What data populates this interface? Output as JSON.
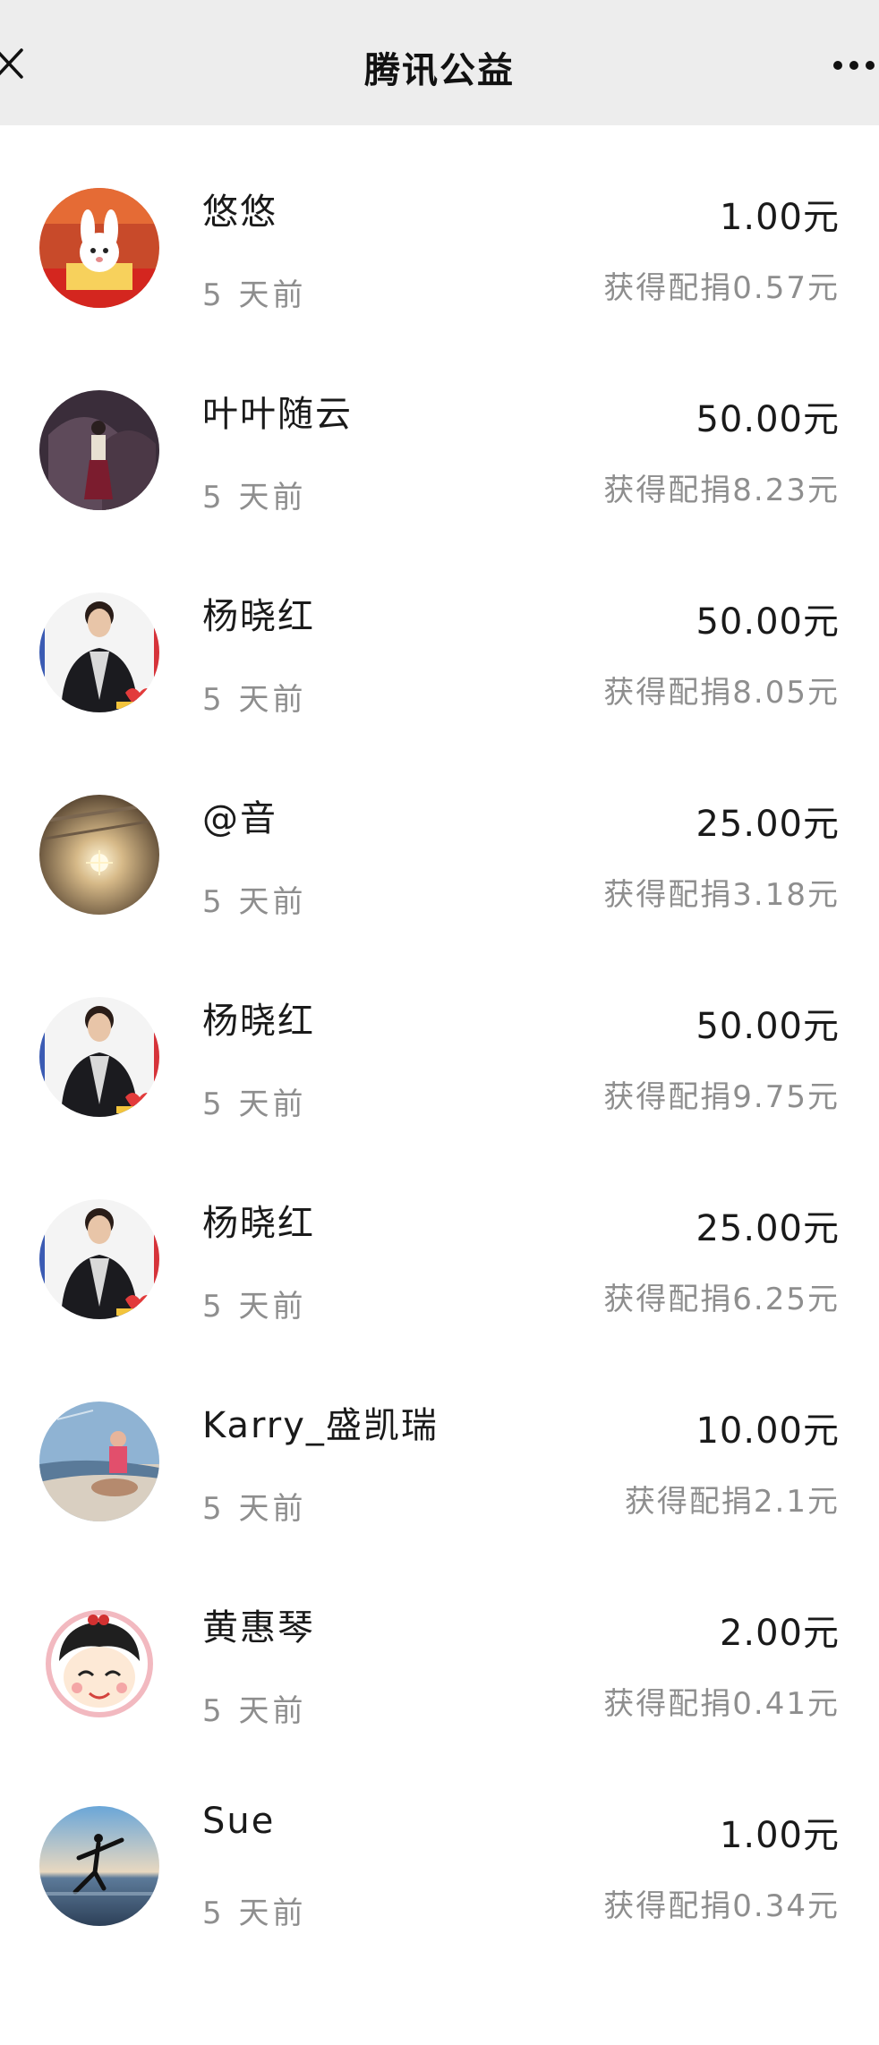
{
  "header": {
    "title": "腾讯公益",
    "close_icon": "close-icon",
    "more_icon": "more-icon"
  },
  "donations": [
    {
      "name": "悠悠",
      "time": "5 天前",
      "amount": "1.00元",
      "match": "获得配捐0.57元",
      "avatar": "rabbit-avatar"
    },
    {
      "name": "叶叶随云",
      "time": "5 天前",
      "amount": "50.00元",
      "match": "获得配捐8.23元",
      "avatar": "woman-archway-avatar"
    },
    {
      "name": "杨晓红",
      "time": "5 天前",
      "amount": "50.00元",
      "match": "获得配捐8.05元",
      "avatar": "woman-portrait-avatar"
    },
    {
      "name": "@音",
      "time": "5 天前",
      "amount": "25.00元",
      "match": "获得配捐3.18元",
      "avatar": "chandelier-avatar"
    },
    {
      "name": "杨晓红",
      "time": "5 天前",
      "amount": "50.00元",
      "match": "获得配捐9.75元",
      "avatar": "woman-portrait-avatar"
    },
    {
      "name": "杨晓红",
      "time": "5 天前",
      "amount": "25.00元",
      "match": "获得配捐6.25元",
      "avatar": "woman-portrait-avatar"
    },
    {
      "name": "Karry_盛凯瑞",
      "time": "5 天前",
      "amount": "10.00元",
      "match": "获得配捐2.1元",
      "avatar": "child-beach-avatar"
    },
    {
      "name": "黄惠琴",
      "time": "5 天前",
      "amount": "2.00元",
      "match": "获得配捐0.41元",
      "avatar": "cartoon-girl-avatar"
    },
    {
      "name": "Sue",
      "time": "5 天前",
      "amount": "1.00元",
      "match": "获得配捐0.34元",
      "avatar": "sunset-dancer-avatar"
    }
  ]
}
